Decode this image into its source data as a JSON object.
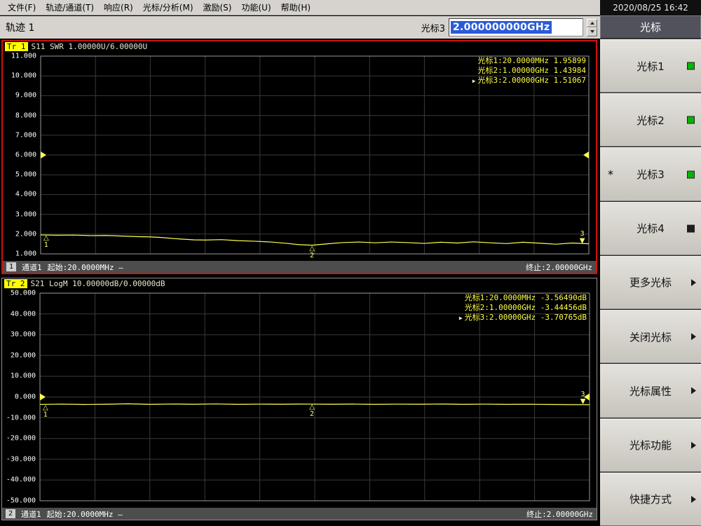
{
  "menubar": {
    "items": [
      {
        "label": "文件(F)"
      },
      {
        "label": "轨迹/通道(T)"
      },
      {
        "label": "响应(R)"
      },
      {
        "label": "光标/分析(M)"
      },
      {
        "label": "激励(S)"
      },
      {
        "label": "功能(U)"
      },
      {
        "label": "帮助(H)"
      }
    ],
    "datetime": "2020/08/25 16:42"
  },
  "toolbar": {
    "trace_label": "轨迹 1",
    "marker_name": "光标3",
    "marker_value": "2.000000000GHz"
  },
  "sidebar": {
    "header": "光标",
    "buttons": [
      {
        "label": "光标1",
        "led": "on"
      },
      {
        "label": "光标2",
        "led": "on"
      },
      {
        "label": "光标3",
        "led": "on",
        "prefix": "*"
      },
      {
        "label": "光标4",
        "led": "off"
      },
      {
        "label": "更多光标",
        "arrow": true
      },
      {
        "label": "关闭光标",
        "arrow": true
      },
      {
        "label": "光标属性",
        "arrow": true
      },
      {
        "label": "光标功能",
        "arrow": true
      },
      {
        "label": "快捷方式",
        "arrow": true
      }
    ]
  },
  "charts": [
    {
      "trace_badge": "Tr 1",
      "title": "S11 SWR 1.00000U/6.00000U",
      "readout": [
        {
          "text": "光标1:20.0000MHz 1.95899"
        },
        {
          "text": "光标2:1.00000GHz 1.43984"
        },
        {
          "text": "光标3:2.00000GHz 1.51067",
          "active": true
        }
      ],
      "channel_badge": "1",
      "channel": "通道1",
      "start": "起始:20.0000MHz —",
      "stop": "终止:2.00000GHz"
    },
    {
      "trace_badge": "Tr 2",
      "title": "S21 LogM 10.00000dB/0.00000dB",
      "readout": [
        {
          "text": "光标1:20.0000MHz -3.56490dB"
        },
        {
          "text": "光标2:1.00000GHz -3.44456dB"
        },
        {
          "text": "光标3:2.00000GHz -3.70765dB",
          "active": true
        }
      ],
      "channel_badge": "2",
      "channel": "通道1",
      "start": "起始:20.0000MHz —",
      "stop": "终止:2.00000GHz"
    }
  ],
  "chart_data": [
    {
      "type": "line",
      "title": "S11 SWR",
      "ylim": [
        1,
        11
      ],
      "ref_level": 6.0,
      "x_range_mhz": [
        20,
        2000
      ],
      "y_ticks": [
        "11.000",
        "10.000",
        "9.000",
        "8.000",
        "7.000",
        "6.000",
        "5.000",
        "4.000",
        "3.000",
        "2.000",
        "1.000"
      ],
      "trace_color": "#ffff50",
      "grid": true,
      "points": [
        [
          0,
          1.96
        ],
        [
          0.03,
          1.945
        ],
        [
          0.06,
          1.95
        ],
        [
          0.09,
          1.925
        ],
        [
          0.12,
          1.93
        ],
        [
          0.15,
          1.9
        ],
        [
          0.18,
          1.87
        ],
        [
          0.2,
          1.86
        ],
        [
          0.22,
          1.83
        ],
        [
          0.25,
          1.76
        ],
        [
          0.28,
          1.71
        ],
        [
          0.3,
          1.7
        ],
        [
          0.33,
          1.72
        ],
        [
          0.36,
          1.67
        ],
        [
          0.39,
          1.64
        ],
        [
          0.42,
          1.6
        ],
        [
          0.45,
          1.53
        ],
        [
          0.47,
          1.47
        ],
        [
          0.495,
          1.44
        ],
        [
          0.52,
          1.5
        ],
        [
          0.55,
          1.57
        ],
        [
          0.58,
          1.6
        ],
        [
          0.61,
          1.56
        ],
        [
          0.64,
          1.6
        ],
        [
          0.67,
          1.57
        ],
        [
          0.7,
          1.53
        ],
        [
          0.73,
          1.59
        ],
        [
          0.76,
          1.55
        ],
        [
          0.79,
          1.61
        ],
        [
          0.82,
          1.56
        ],
        [
          0.85,
          1.52
        ],
        [
          0.88,
          1.59
        ],
        [
          0.91,
          1.54
        ],
        [
          0.94,
          1.49
        ],
        [
          0.97,
          1.55
        ],
        [
          1,
          1.51
        ]
      ],
      "markers": [
        {
          "n": "1",
          "x": 0.0,
          "value": 1.95899
        },
        {
          "n": "2",
          "x": 0.495,
          "value": 1.43984
        },
        {
          "n": "3",
          "x": 1.0,
          "value": 1.51067,
          "active": true
        }
      ]
    },
    {
      "type": "line",
      "title": "S21 LogM",
      "ylim": [
        -50,
        50
      ],
      "ref_level": 0.0,
      "x_range_mhz": [
        20,
        2000
      ],
      "y_ticks": [
        "50.000",
        "40.000",
        "30.000",
        "20.000",
        "10.000",
        "0.000",
        "-10.000",
        "-20.000",
        "-30.000",
        "-40.000",
        "-50.000"
      ],
      "trace_color": "#ffff50",
      "grid": true,
      "points": [
        [
          0,
          -3.56
        ],
        [
          0.04,
          -3.45
        ],
        [
          0.08,
          -3.6
        ],
        [
          0.12,
          -3.5
        ],
        [
          0.16,
          -3.3
        ],
        [
          0.2,
          -3.55
        ],
        [
          0.24,
          -3.4
        ],
        [
          0.28,
          -3.5
        ],
        [
          0.32,
          -3.35
        ],
        [
          0.36,
          -3.55
        ],
        [
          0.4,
          -3.45
        ],
        [
          0.44,
          -3.5
        ],
        [
          0.47,
          -3.42
        ],
        [
          0.495,
          -3.44
        ],
        [
          0.53,
          -3.5
        ],
        [
          0.57,
          -3.42
        ],
        [
          0.61,
          -3.55
        ],
        [
          0.65,
          -3.45
        ],
        [
          0.69,
          -3.5
        ],
        [
          0.73,
          -3.4
        ],
        [
          0.77,
          -3.55
        ],
        [
          0.81,
          -3.45
        ],
        [
          0.85,
          -3.55
        ],
        [
          0.89,
          -3.5
        ],
        [
          0.93,
          -3.6
        ],
        [
          0.96,
          -3.68
        ],
        [
          1,
          -3.71
        ]
      ],
      "markers": [
        {
          "n": "1",
          "x": 0.0,
          "value": -3.5649
        },
        {
          "n": "2",
          "x": 0.495,
          "value": -3.44456
        },
        {
          "n": "3",
          "x": 1.0,
          "value": -3.70765,
          "active": true
        }
      ]
    }
  ],
  "colors": {
    "active_chart_border": "#cf1010",
    "trace": "#ffff50",
    "led_on": "#00b400",
    "marker": "#ffff66",
    "readout_text": "#ffff44",
    "selection_blue": "#2b5bd7"
  }
}
